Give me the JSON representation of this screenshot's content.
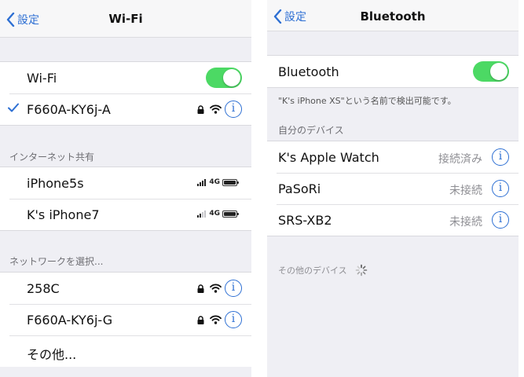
{
  "wifi_screen": {
    "nav": {
      "back_label": "設定",
      "title": "Wi-Fi"
    },
    "wifi_toggle": {
      "label": "Wi-Fi",
      "on": true
    },
    "connected": {
      "name": "F660A-KY6j-A",
      "info": "i"
    },
    "hotspot_section": {
      "header": "インターネット共有",
      "items": [
        {
          "name": "iPhone5s",
          "network": "4G",
          "signal_bars": 4
        },
        {
          "name": "K's iPhone7",
          "network": "4G",
          "signal_bars": 2
        }
      ]
    },
    "networks_section": {
      "header": "ネットワークを選択...",
      "items": [
        {
          "name": "258C",
          "info": "i"
        },
        {
          "name": "F660A-KY6j-G",
          "info": "i"
        }
      ],
      "other_label": "その他..."
    }
  },
  "bluetooth_screen": {
    "nav": {
      "back_label": "設定",
      "title": "Bluetooth"
    },
    "bt_toggle": {
      "label": "Bluetooth",
      "on": true
    },
    "description": "\"K's iPhone XS\"という名前で検出可能です。",
    "my_devices": {
      "header": "自分のデバイス",
      "items": [
        {
          "name": "K's Apple Watch",
          "status": "接続済み",
          "info": "i"
        },
        {
          "name": "PaSoRi",
          "status": "未接続",
          "info": "i"
        },
        {
          "name": "SRS-XB2",
          "status": "未接続",
          "info": "i"
        }
      ]
    },
    "other_devices": {
      "header": "その他のデバイス"
    }
  },
  "colors": {
    "accent": "#2d6fd3",
    "toggle_on": "#4cd964",
    "background": "#efeff4"
  }
}
